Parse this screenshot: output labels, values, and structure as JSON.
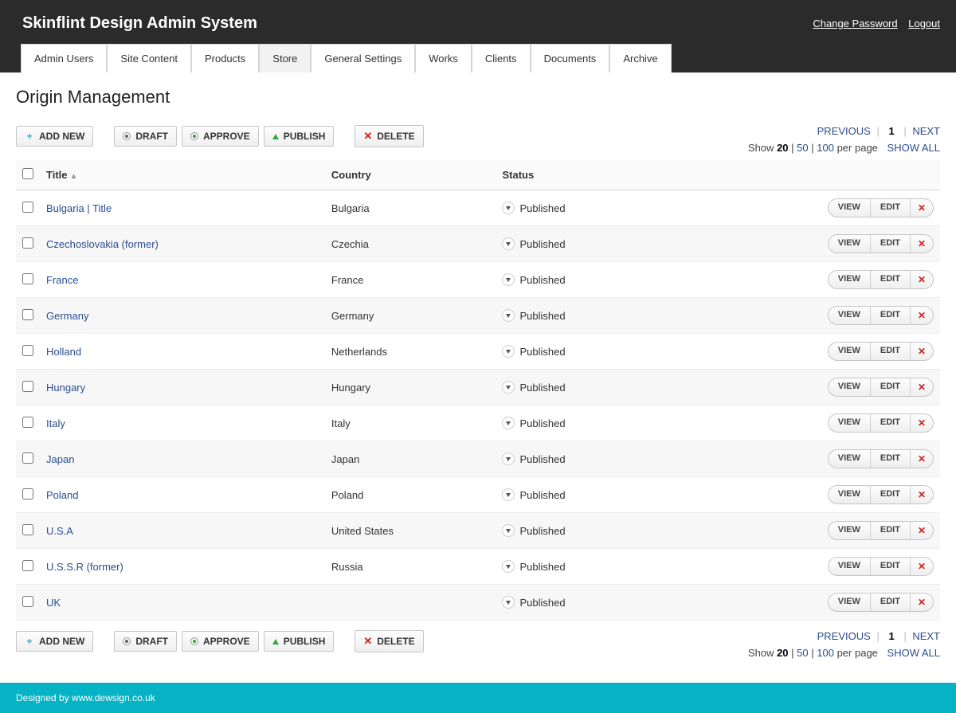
{
  "header": {
    "title": "Skinflint Design Admin System",
    "change_password": "Change Password",
    "logout": "Logout"
  },
  "nav": {
    "items": [
      "Admin Users",
      "Site Content",
      "Products",
      "Store",
      "General Settings",
      "Works",
      "Clients",
      "Documents",
      "Archive"
    ],
    "active_index": 3
  },
  "page": {
    "title": "Origin Management"
  },
  "toolbar": {
    "add_new": "ADD NEW",
    "draft": "DRAFT",
    "approve": "APPROVE",
    "publish": "PUBLISH",
    "delete": "DELETE"
  },
  "pager": {
    "previous": "PREVIOUS",
    "next": "NEXT",
    "current_page": "1",
    "show_label": "Show",
    "opt1": "20",
    "opt2": "50",
    "opt3": "100",
    "per_page": "per page",
    "show_all": "SHOW ALL"
  },
  "columns": {
    "title": "Title",
    "country": "Country",
    "status": "Status"
  },
  "buttons": {
    "view": "VIEW",
    "edit": "EDIT"
  },
  "rows": [
    {
      "title": "Bulgaria | Title",
      "country": "Bulgaria",
      "status": "Published"
    },
    {
      "title": "Czechoslovakia (former)",
      "country": "Czechia",
      "status": "Published"
    },
    {
      "title": "France",
      "country": "France",
      "status": "Published"
    },
    {
      "title": "Germany",
      "country": "Germany",
      "status": "Published"
    },
    {
      "title": "Holland",
      "country": "Netherlands",
      "status": "Published"
    },
    {
      "title": "Hungary",
      "country": "Hungary",
      "status": "Published"
    },
    {
      "title": "Italy",
      "country": "Italy",
      "status": "Published"
    },
    {
      "title": "Japan",
      "country": "Japan",
      "status": "Published"
    },
    {
      "title": "Poland",
      "country": "Poland",
      "status": "Published"
    },
    {
      "title": "U.S.A",
      "country": "United States",
      "status": "Published"
    },
    {
      "title": "U.S.S.R (former)",
      "country": "Russia",
      "status": "Published"
    },
    {
      "title": "UK",
      "country": "",
      "status": "Published"
    }
  ],
  "footer": {
    "designed_by": "Designed by ",
    "link_text": "www.dewsign.co.uk"
  }
}
